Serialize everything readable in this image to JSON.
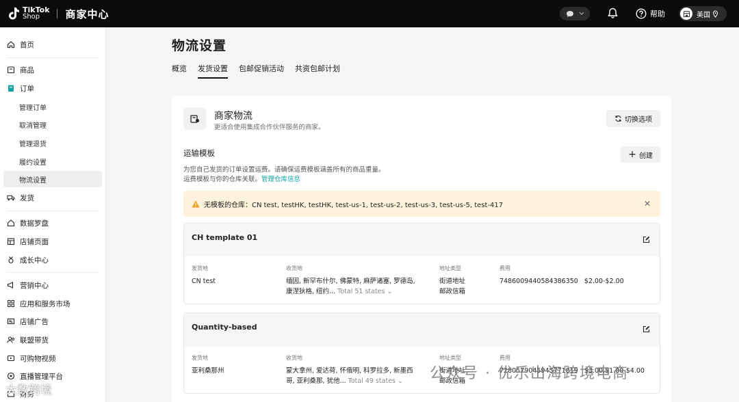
{
  "topbar": {
    "logo_line1": "TikTok",
    "logo_line2": "Shop",
    "title": "商家中心",
    "help": "帮助",
    "region": "美国"
  },
  "sidebar": {
    "items": [
      {
        "label": "首页",
        "icon": "home-icon"
      },
      {
        "label": "商品",
        "icon": "box-icon"
      },
      {
        "label": "订单",
        "icon": "order-icon"
      },
      {
        "label": "管理订单"
      },
      {
        "label": "取消管理"
      },
      {
        "label": "管理退货"
      },
      {
        "label": "履约设置"
      },
      {
        "label": "物流设置"
      },
      {
        "label": "发货",
        "icon": "truck-icon"
      },
      {
        "label": "数据罗盘",
        "icon": "compass-icon"
      },
      {
        "label": "店铺页面",
        "icon": "shop-icon"
      },
      {
        "label": "成长中心",
        "icon": "medal-icon"
      },
      {
        "label": "营销中心",
        "icon": "megaphone-icon"
      },
      {
        "label": "应用和服务市场",
        "icon": "apps-icon"
      },
      {
        "label": "店铺广告",
        "icon": "ad-icon"
      },
      {
        "label": "联盟带货",
        "icon": "people-icon"
      },
      {
        "label": "可购物视频",
        "icon": "video-icon"
      },
      {
        "label": "直播管理平台",
        "icon": "live-icon"
      },
      {
        "label": "财务",
        "icon": "finance-icon"
      }
    ]
  },
  "page": {
    "title": "物流设置",
    "tabs": [
      "概览",
      "发货设置",
      "包邮促销活动",
      "共资包邮计划"
    ]
  },
  "card": {
    "title": "商家物流",
    "subtitle": "更适合使用集成合作伙伴服务的商家。",
    "switch_label": "切换选项",
    "section_title": "运输模板",
    "desc1": "为您自己发货的订单设置运费。请确保运费模板涵盖所有的商品重量。",
    "desc2": "运费模板与你的仓库关联。",
    "desc2_link": "管理仓库信息",
    "create_label": "创建",
    "warning": "无模板的仓库：CN test, testHK, testHK, test-us-1, test-us-2, test-us-3, test-us-5, test-417"
  },
  "templates": [
    {
      "name": "CH template 01",
      "labels": {
        "origin": "发货地",
        "dest": "收货地",
        "addr_type": "地址类型",
        "fee": "费用"
      },
      "origin": "CN test",
      "dest_line1": "缅因, 新罕布什尔, 佛蒙特, 麻萨诸塞, 罗德岛,",
      "dest_line2": "康涅狄格, 纽约...",
      "dest_total": "Total 51 states",
      "addr_line1": "街道地址",
      "addr_line2": "邮政信箱",
      "fee_id": "7486009440584386350",
      "fee_range": "$2.00-$2.00"
    },
    {
      "name": "Quantity-based",
      "labels": {
        "origin": "发货地",
        "dest": "收货地",
        "addr_type": "地址类型",
        "fee": "费用"
      },
      "origin": "亚利桑那州",
      "dest_line1": "蒙大拿州, 爱达荷, 怀俄明, 科罗拉多, 新墨西",
      "dest_line2": "哥, 亚利桑那, 犹他...",
      "dest_total": "Total 49 states",
      "addr_line1": "街道地址",
      "addr_line2": "邮政信箱",
      "fee_id": "7280579045945771819",
      "fee_range": "$3.00,$1.00-$4.00"
    }
  ],
  "watermark": {
    "right": "公众号 · 优乐出海跨境电商",
    "left": "大数跨境"
  },
  "colors": {
    "accent_link": "#10a3a3",
    "warn_bg": "#fdf3dc",
    "warn_icon": "#f0a020",
    "topbar": "#0b0b0b"
  }
}
